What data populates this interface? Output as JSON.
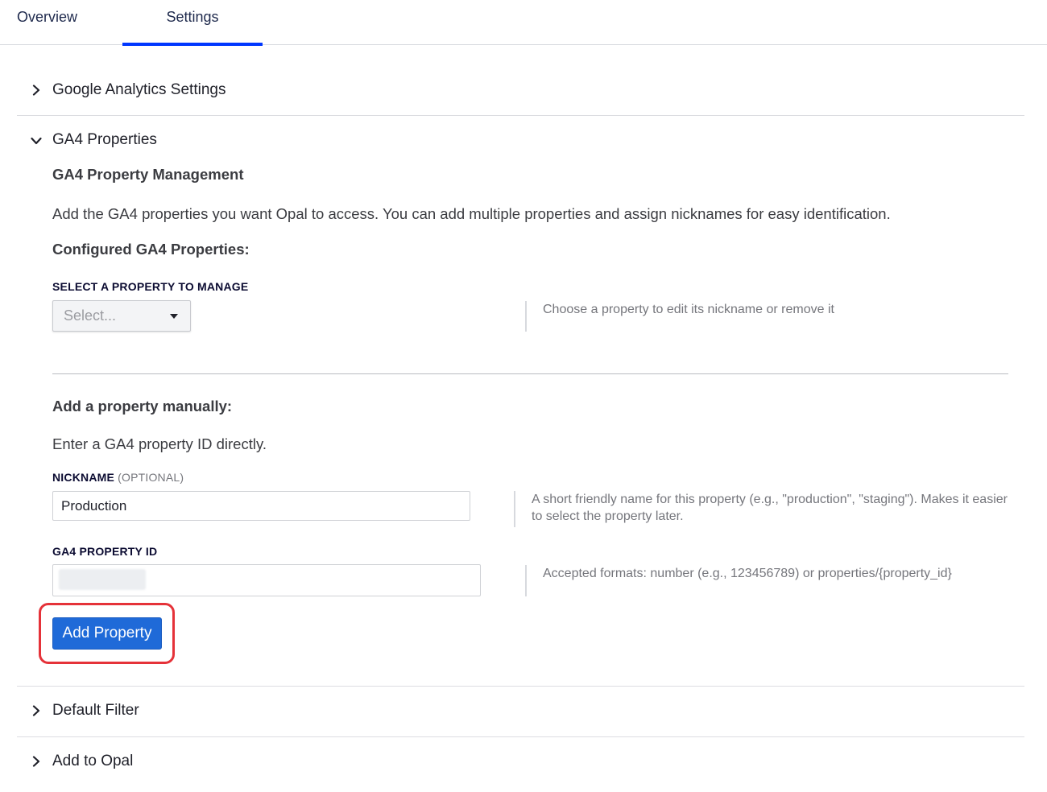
{
  "tabs": {
    "overview": "Overview",
    "settings": "Settings"
  },
  "sections": {
    "google_analytics_settings": "Google Analytics Settings",
    "ga4_properties": "GA4 Properties",
    "default_filter": "Default Filter",
    "add_to_opal": "Add to Opal"
  },
  "ga4": {
    "management_title": "GA4 Property Management",
    "description": "Add the GA4 properties you want Opal to access. You can add multiple properties and assign nicknames for easy identification.",
    "configured_title": "Configured GA4 Properties:",
    "select_label": "SELECT A PROPERTY TO MANAGE",
    "select_placeholder": "Select...",
    "select_help": "Choose a property to edit its nickname or remove it",
    "manual_title": "Add a property manually:",
    "manual_description": "Enter a GA4 property ID directly.",
    "nickname_label": "NICKNAME",
    "nickname_optional": "(OPTIONAL)",
    "nickname_value": "Production",
    "nickname_help": "A short friendly name for this property (e.g., \"production\", \"staging\"). Makes it easier to select the property later.",
    "property_id_label": "GA4 PROPERTY ID",
    "property_id_value": "",
    "property_id_help": "Accepted formats: number (e.g., 123456789) or properties/{property_id}",
    "add_button": "Add Property"
  },
  "colors": {
    "tab_active_underline": "#0037ff",
    "button_bg": "#1f6ad8",
    "highlight_ring": "#e53239"
  },
  "icons": {
    "collapsed": "chevron-right-icon",
    "expanded": "chevron-down-icon",
    "select_caret": "caret-down-icon"
  }
}
